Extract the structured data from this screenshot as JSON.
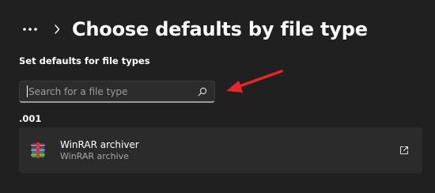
{
  "header": {
    "more_icon": "ellipsis-icon",
    "separator_icon": "chevron-right-icon",
    "title": "Choose defaults by file type"
  },
  "section": {
    "label": "Set defaults for file types"
  },
  "search": {
    "placeholder": "Search for a file type",
    "value": "",
    "icon": "search-icon"
  },
  "annotation": {
    "color": "#e8262a"
  },
  "file_types": [
    {
      "extension": ".001",
      "app_name": "WinRAR archiver",
      "app_description": "WinRAR archive",
      "app_icon": "winrar-icon",
      "action_icon": "open-external-icon"
    }
  ],
  "colors": {
    "background": "#202020",
    "card": "#2b2b2b",
    "text": "#ffffff",
    "secondary_text": "#a6a6a6"
  }
}
